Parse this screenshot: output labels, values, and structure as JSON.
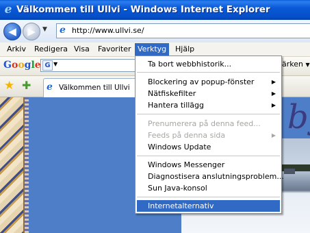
{
  "window": {
    "title": "Välkommen till Ullvi - Windows Internet Explorer"
  },
  "address": {
    "url": "http://www.ullvi.se/"
  },
  "menubar": [
    "Arkiv",
    "Redigera",
    "Visa",
    "Favoriter",
    "Verktyg",
    "Hjälp"
  ],
  "google_toolbar": {
    "logo": "Google",
    "bookmarks_label": "ärken"
  },
  "tab": {
    "title": "Välkommen till Ullvi"
  },
  "page": {
    "heading_fragment": "by"
  },
  "tools_menu": {
    "items": [
      {
        "label": "Ta bort webbhistorik...",
        "enabled": true,
        "submenu": false
      },
      {
        "label": "Blockering av popup-fönster",
        "enabled": true,
        "submenu": true
      },
      {
        "label": "Nätfiskefilter",
        "enabled": true,
        "submenu": true
      },
      {
        "label": "Hantera tillägg",
        "enabled": true,
        "submenu": true
      },
      {
        "label": "Prenumerera på denna feed...",
        "enabled": false,
        "submenu": false
      },
      {
        "label": "Feeds på denna sida",
        "enabled": false,
        "submenu": true
      },
      {
        "label": "Windows Update",
        "enabled": true,
        "submenu": false
      },
      {
        "label": "Windows Messenger",
        "enabled": true,
        "submenu": false
      },
      {
        "label": "Diagnostisera anslutningsproblem...",
        "enabled": true,
        "submenu": false
      },
      {
        "label": "Sun Java-konsol",
        "enabled": true,
        "submenu": false
      },
      {
        "label": "Internetalternativ",
        "enabled": true,
        "submenu": false,
        "selected": true
      }
    ]
  },
  "colors": {
    "titlebar": "#0a58d6",
    "menu_highlight": "#316ac5"
  }
}
